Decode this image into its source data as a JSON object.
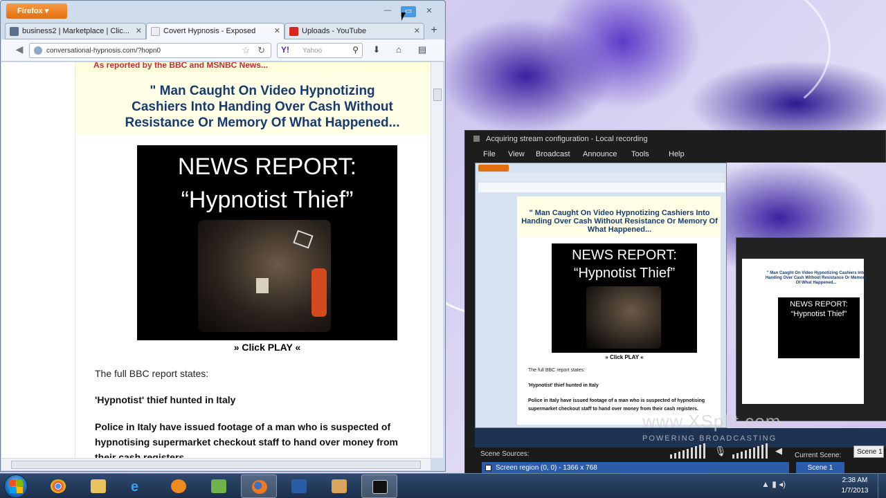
{
  "firefox": {
    "menu_label": "Firefox ▾",
    "tabs": [
      {
        "label": "business2 | Marketplace | Clic..."
      },
      {
        "label": "Covert Hypnosis - Exposed"
      },
      {
        "label": "Uploads - YouTube"
      }
    ],
    "new_tab": "+",
    "url": "conversational-hypnosis.com/?hopn0",
    "search_placeholder": "Yahoo",
    "icons": [
      "back-icon",
      "globe-icon",
      "star-icon",
      "reload-icon",
      "yahoo-icon",
      "search-icon",
      "download-icon",
      "home-icon",
      "bookmarks-icon"
    ]
  },
  "page": {
    "top_line": "As reported by the BBC and MSNBC News...",
    "headline_lines": [
      "\" Man Caught On Video Hypnotizing",
      "Cashiers Into Handing Over Cash Without",
      "Resistance Or Memory Of What Happened..."
    ],
    "video_line1": "NEWS REPORT:",
    "video_line2": "“Hypnotist Thief”",
    "click_play": "» Click PLAY «",
    "para1": "The full BBC report states:",
    "para2": "'Hypnotist' thief hunted in Italy",
    "para3": "Police in Italy have issued footage of a man who is suspected of hypnotising supermarket checkout staff to hand over money from their cash registers."
  },
  "xsplit": {
    "title": "Acquiring stream configuration - Local recording",
    "menu": [
      "File",
      "View",
      "Broadcast",
      "Announce",
      "Tools",
      "Help"
    ],
    "preview_headline": "\" Man Caught On Video Hypnotizing Cashiers Into Handing Over Cash Without Resistance Or Memory Of What Happened...",
    "preview_video_line1": "NEWS REPORT:",
    "preview_video_line2": "“Hypnotist Thief”",
    "preview_click": "» Click PLAY «",
    "preview_t1": "The full BBC report states:",
    "preview_t2": "'Hypnotist' thief hunted in Italy",
    "preview_t3": "Police in Italy have issued footage of a man who is suspected of hypnotising supermarket checkout staff to hand over money from their cash registers.",
    "nested_head": "\" Man Caught On Video Hypnotizing Cashiers Into Handing Over Cash Without Resistance Or Memory Of What Happened...",
    "nested_v1": "NEWS REPORT:",
    "nested_v2": "“Hypnotist Thief”",
    "watermark": "www.XSplit.com",
    "watermark_sub": "POWERING BROADCASTING",
    "scene_sources_label": "Scene Sources:",
    "source_item": "Screen region (0, 0) - 1366 x 768",
    "current_scene_label": "Current Scene:",
    "scene_select": "Scene 1",
    "scene_button": "Scene 1"
  },
  "taskbar": {
    "apps": [
      "start-orb",
      "chrome",
      "explorer",
      "internet-explorer",
      "media-player",
      "network",
      "firefox",
      "word",
      "paint",
      "xsplit"
    ],
    "time": "2:38 AM",
    "date": "1/7/2013",
    "tray": "▲ ▮ ◂)"
  },
  "colors": {
    "headline": "#173a72",
    "firefox_orange": "#e36e10",
    "xsplit_bg": "#1d1d1d",
    "selection_blue": "#2a5caa",
    "taskbar": "#1b2f4b"
  }
}
